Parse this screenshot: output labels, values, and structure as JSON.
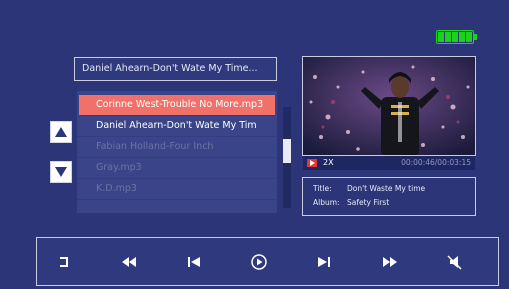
{
  "now_playing": {
    "title": "Daniel Ahearn-Don't Wate My Time..."
  },
  "playlist": {
    "items": [
      {
        "label": "Corinne West-Trouble No More.mp3"
      },
      {
        "label": "Daniel Ahearn-Don't Wate My Tim"
      },
      {
        "label": "Fabian Holland-Four Inch"
      },
      {
        "label": "Gray.mp3"
      },
      {
        "label": "K.D.mp3"
      }
    ]
  },
  "video": {
    "speed": "2X",
    "time": "00:00:46/00:03:15"
  },
  "info": {
    "title_label": "Title:",
    "title_value": "Don't Waste My time",
    "album_label": "Album:",
    "album_value": "Safety First"
  },
  "battery": {
    "level": 1.0
  },
  "colors": {
    "background": "#2c3578",
    "highlight": "#f0716a",
    "battery": "#1cd21c"
  },
  "icons": {
    "controls": [
      "return-icon",
      "fast-rewind-icon",
      "previous-icon",
      "play-icon",
      "next-icon",
      "fast-forward-icon",
      "mute-icon"
    ]
  }
}
